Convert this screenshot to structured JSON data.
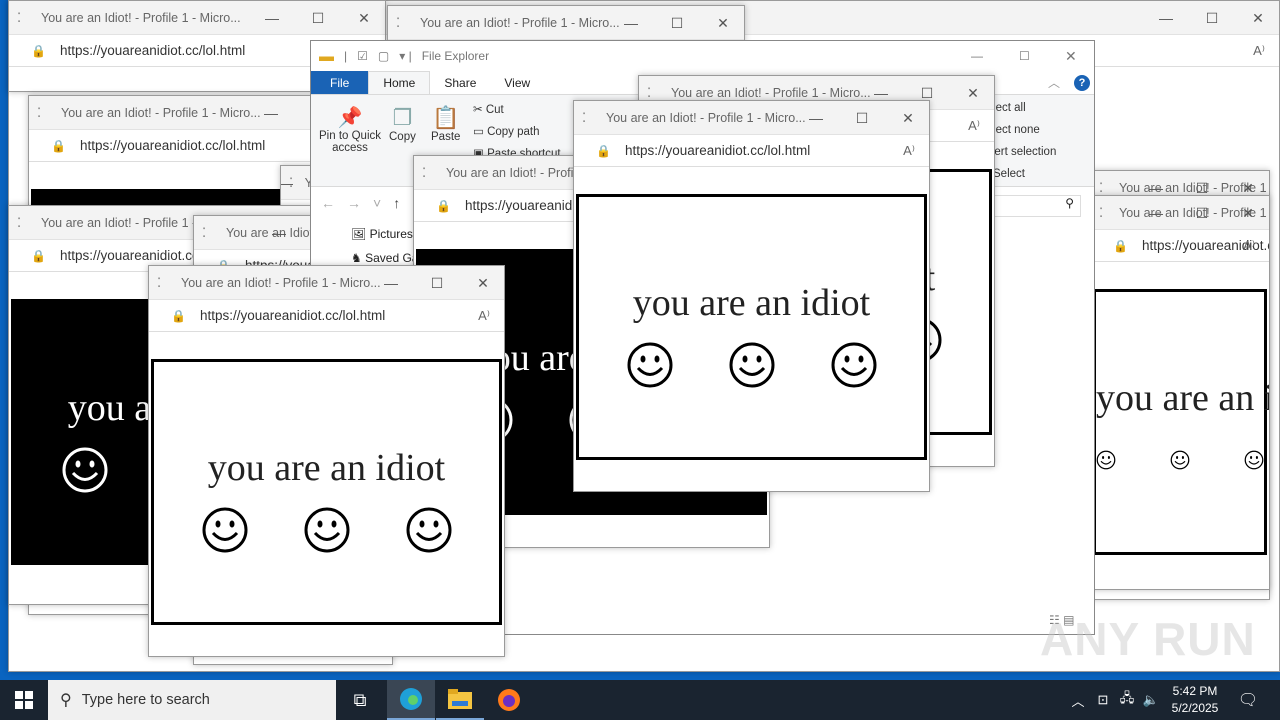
{
  "browser": {
    "title": "You are an Idiot! - Profile 1 - Micro...",
    "title_short_a": "You are an Idiot! - Profile 1 - M",
    "title_short_b": "You are an Idiot! - Profile",
    "title_short_c": "You are an Idiot! -",
    "url": "https://youareanidiot.cc/lol.html",
    "url_partial": "https://youareanidiot.cc/",
    "page_text": "you are an idiot",
    "minimize": "—",
    "maximize": "☐",
    "close": "✕",
    "lock": "🔒",
    "read_aloud": "A⁾"
  },
  "explorer": {
    "title": "File Explorer",
    "tabs": [
      "File",
      "Home",
      "Share",
      "View"
    ],
    "ribbon": {
      "pin": "Pin to Quick access",
      "copy": "Copy",
      "paste": "Paste",
      "cut": "Cut",
      "copy_path": "Copy path",
      "paste_shortcut": "Paste shortcut",
      "select_all": "Select all",
      "select_none": "Select none",
      "invert_selection": "Invert selection",
      "select_group": "Select"
    },
    "nav": [
      "Pictures",
      "Saved Games"
    ]
  },
  "taskbar": {
    "search_placeholder": "Type here to search",
    "time": "5:42 PM",
    "date": "5/2/2025"
  },
  "watermark": "ANY RUN"
}
